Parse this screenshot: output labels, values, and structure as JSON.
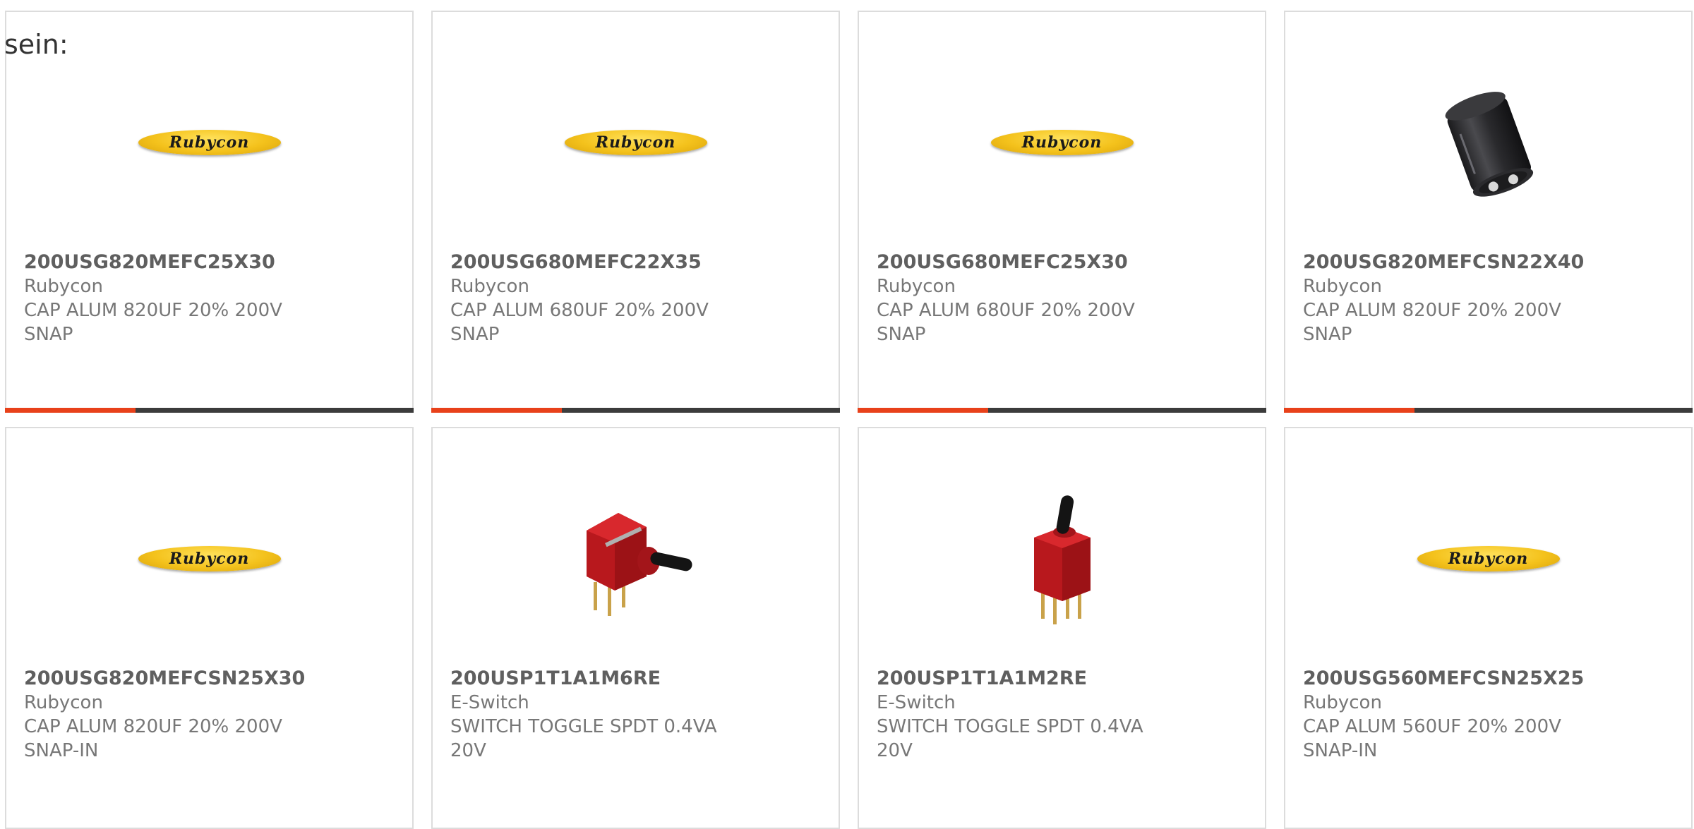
{
  "intro_text": "sein:",
  "products": [
    {
      "part_number": "200USG820MEFC25X30",
      "manufacturer": "Rubycon",
      "description": "CAP ALUM 820UF 20% 200V SNAP",
      "image": "rubycon-logo",
      "logo_text": "Rubycon",
      "progress": 0.32
    },
    {
      "part_number": "200USG680MEFC22X35",
      "manufacturer": "Rubycon",
      "description": "CAP ALUM 680UF 20% 200V SNAP",
      "image": "rubycon-logo",
      "logo_text": "Rubycon",
      "progress": 0.32
    },
    {
      "part_number": "200USG680MEFC25X30",
      "manufacturer": "Rubycon",
      "description": "CAP ALUM 680UF 20% 200V SNAP",
      "image": "rubycon-logo",
      "logo_text": "Rubycon",
      "progress": 0.32
    },
    {
      "part_number": "200USG820MEFCSN22X40",
      "manufacturer": "Rubycon",
      "description": "CAP ALUM 820UF 20% 200V SNAP",
      "image": "capacitor-photo",
      "progress": 0.32
    },
    {
      "part_number": "200USG820MEFCSN25X30",
      "manufacturer": "Rubycon",
      "description": "CAP ALUM 820UF 20% 200V SNAP-IN",
      "image": "rubycon-logo",
      "logo_text": "Rubycon"
    },
    {
      "part_number": "200USP1T1A1M6RE",
      "manufacturer": "E-Switch",
      "description": "SWITCH TOGGLE SPDT 0.4VA 20V",
      "image": "toggle-switch-right-angle-photo"
    },
    {
      "part_number": "200USP1T1A1M2RE",
      "manufacturer": "E-Switch",
      "description": "SWITCH TOGGLE SPDT 0.4VA 20V",
      "image": "toggle-switch-vertical-photo"
    },
    {
      "part_number": "200USG560MEFCSN25X25",
      "manufacturer": "Rubycon",
      "description": "CAP ALUM 560UF 20% 200V SNAP-IN",
      "image": "rubycon-logo",
      "logo_text": "Rubycon"
    }
  ],
  "colors": {
    "progress_fill": "#e8411a",
    "progress_track": "#3c3c3c",
    "logo_yellow": "#f4c21c",
    "switch_red": "#c2191e"
  }
}
